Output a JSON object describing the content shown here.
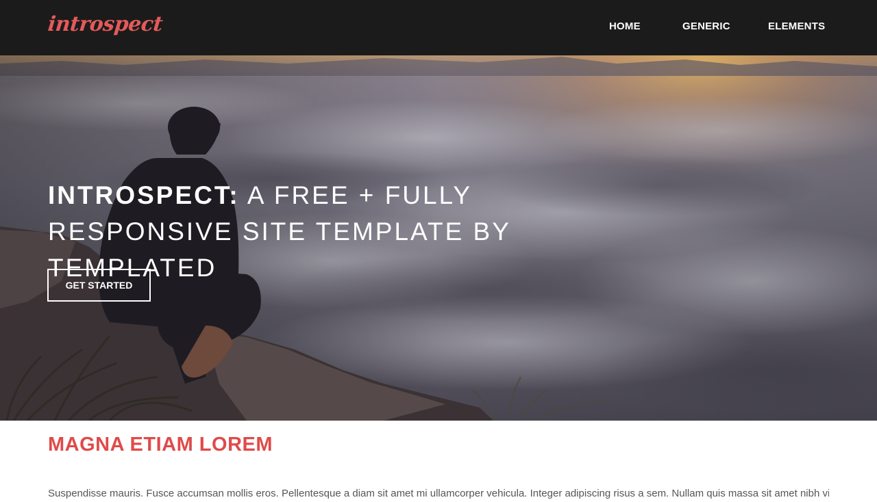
{
  "header": {
    "logo": "introspect",
    "nav": [
      {
        "label": "HOME"
      },
      {
        "label": "GENERIC"
      },
      {
        "label": "ELEMENTS"
      }
    ]
  },
  "banner": {
    "title_strong": "INTROSPECT:",
    "title_rest": " A FREE + FULLY RESPONSIVE SITE TEMPLATE BY TEMPLATED",
    "button_label": "GET STARTED"
  },
  "main": {
    "heading": "MAGNA ETIAM LOREM",
    "paragraph": "Suspendisse mauris. Fusce accumsan mollis eros. Pellentesque a diam sit amet mi ullamcorper vehicula. Integer adipiscing risus a sem. Nullam quis massa sit amet nibh viverra malesuada."
  },
  "colors": {
    "header_bg": "#1b1b1b",
    "accent": "#e04a4a",
    "logo": "#e35a5a"
  }
}
